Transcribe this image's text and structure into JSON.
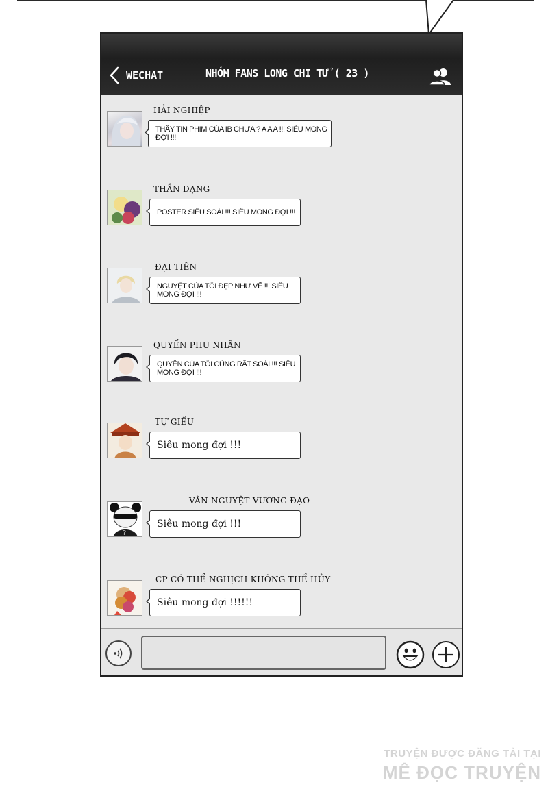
{
  "header": {
    "back_label": "WECHAT",
    "title": "NHÓM FANS LONG CHI TỬ ( 23 )"
  },
  "messages": [
    {
      "name": "HẢI NGHIỆP",
      "text": "THẤY TIN PHIM CỦA IB CHƯA ? A A A !!! SIÊU MONG ĐỢI !!!"
    },
    {
      "name": "THẦN DẠNG",
      "text": "POSTER SIÊU SOÁI !!! SIÊU MONG ĐỢI !!!"
    },
    {
      "name": "ĐẠI TIÊN",
      "text": "NGUYỆT CỦA TÔI ĐẸP NHƯ VẼ !!! SIÊU MONG ĐỢI !!!"
    },
    {
      "name": "QUYỂN PHU NHÂN",
      "text": "QUYỂN CỦA TÔI CŨNG RẤT SOÁI !!! SIÊU MONG ĐỢI !!!"
    },
    {
      "name": "TỰ GIỂU",
      "text": "Siêu mong đợi !!!"
    },
    {
      "name": "VÂN NGUYỆT VƯƠNG ĐẠO",
      "text": "Siêu mong đợi !!!"
    },
    {
      "name": "CP CÓ THỂ NGHỊCH KHÔNG THỂ HỦY",
      "text": "Siêu mong đợi !!!!!!"
    }
  ],
  "watermark": {
    "line1": "TRUYỆN ĐƯỢC ĐĂNG TẢI TẠI",
    "line2": "MÊ ĐỌC TRUYỆN"
  },
  "icons": {
    "back": "chevron-left-icon",
    "group": "people-icon",
    "voice": "voice-icon",
    "emoji": "smiley-icon",
    "add": "plus-icon"
  },
  "colors": {
    "header_bg": "#2c2c2c",
    "chat_bg": "#e9e9e9",
    "bubble_bg": "#ffffff"
  }
}
